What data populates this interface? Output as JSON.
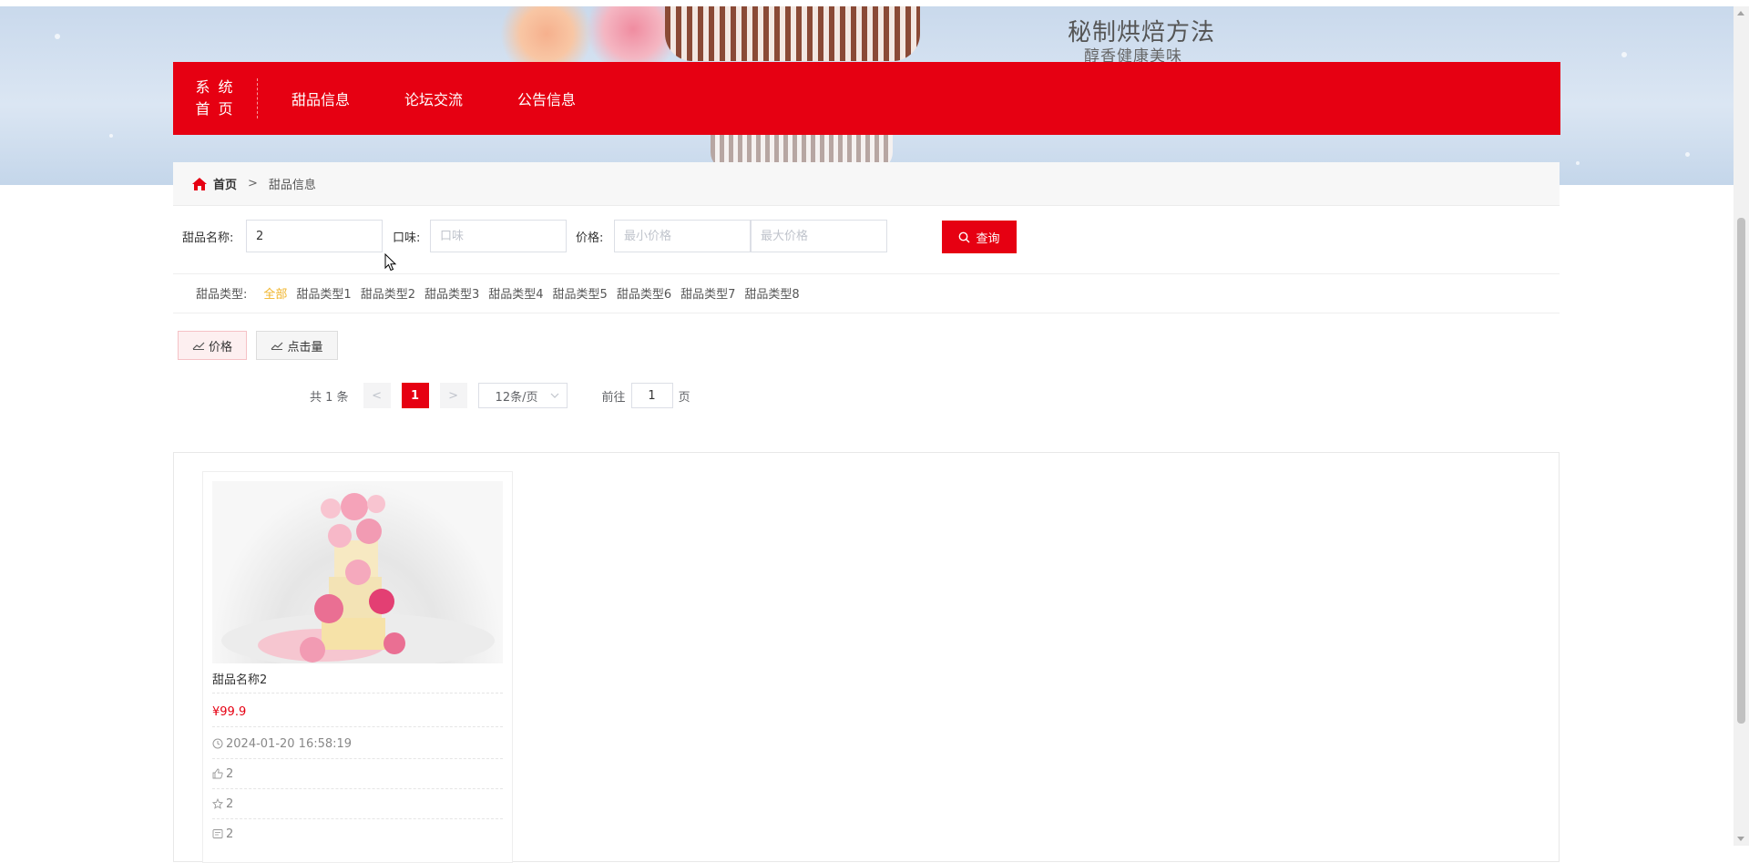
{
  "banner": {
    "slogan": "秘制烘焙方法",
    "slogan_sub": "醇香健康美味"
  },
  "nav": {
    "brand_line1": "系 统",
    "brand_line2": "首 页",
    "items": [
      {
        "label": "甜品信息"
      },
      {
        "label": "论坛交流"
      },
      {
        "label": "公告信息"
      }
    ]
  },
  "breadcrumb": {
    "home": "首页",
    "separator": ">",
    "current": "甜品信息"
  },
  "search": {
    "name_label": "甜品名称:",
    "name_value": "2",
    "taste_label": "口味:",
    "taste_placeholder": "口味",
    "price_label": "价格:",
    "min_price_placeholder": "最小价格",
    "max_price_placeholder": "最大价格",
    "button_label": "查询"
  },
  "types": {
    "label": "甜品类型:",
    "items": [
      "全部",
      "甜品类型1",
      "甜品类型2",
      "甜品类型3",
      "甜品类型4",
      "甜品类型5",
      "甜品类型6",
      "甜品类型7",
      "甜品类型8"
    ],
    "active": "全部"
  },
  "sort": {
    "price_label": "价格",
    "clicks_label": "点击量"
  },
  "pagination": {
    "total": "共 1 条",
    "prev": "<",
    "current_page": "1",
    "next": ">",
    "page_size": "12条/页",
    "jump_prefix": "前往",
    "jump_value": "1",
    "jump_suffix": "页"
  },
  "products": [
    {
      "name": "甜品名称2",
      "price": "¥99.9",
      "time": "2024-01-20 16:58:19",
      "likes": "2",
      "favorites": "2",
      "comments": "2"
    }
  ],
  "colors": {
    "brand_red": "#e60012",
    "active_type": "#f0b429"
  }
}
